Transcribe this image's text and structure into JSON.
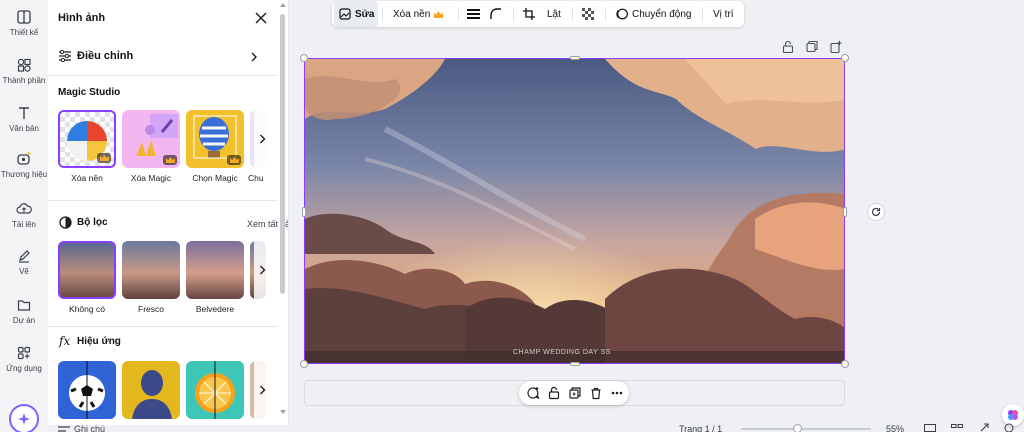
{
  "rail": {
    "items": [
      {
        "label": "Thiết kế",
        "icon": "layout-icon"
      },
      {
        "label": "Thành phần",
        "icon": "shapes-icon"
      },
      {
        "label": "Văn bản",
        "icon": "text-icon"
      },
      {
        "label": "Thương hiệu",
        "icon": "brand-icon"
      },
      {
        "label": "Tải lên",
        "icon": "upload-cloud-icon"
      },
      {
        "label": "Vẽ",
        "icon": "pen-icon"
      },
      {
        "label": "Dự án",
        "icon": "folder-icon"
      },
      {
        "label": "Ứng dụng",
        "icon": "apps-icon"
      }
    ]
  },
  "panel": {
    "title": "Hình ảnh",
    "adjust_label": "Điều chỉnh",
    "magic_studio": {
      "heading": "Magic Studio",
      "items": [
        "Xóa nền",
        "Xóa Magic",
        "Chọn Magic",
        "Chu"
      ]
    },
    "filters": {
      "heading": "Bộ lọc",
      "see_all": "Xem tất cả",
      "items": [
        "Không có",
        "Fresco",
        "Belvedere"
      ]
    },
    "effects": {
      "heading": "Hiệu ứng"
    }
  },
  "toolbar": {
    "edit": "Sửa",
    "remove_bg": "Xóa nền",
    "flip": "Lật",
    "animate": "Chuyển động",
    "position": "Vị trí"
  },
  "canvas": {
    "watermark": "CHAMP WEDDING DAY SS"
  },
  "bottom": {
    "notes": "Ghi chú",
    "page": "Trang 1 / 1",
    "zoom": "55%"
  },
  "colors": {
    "accent": "#8b3dff",
    "crown": "#f5a623"
  }
}
